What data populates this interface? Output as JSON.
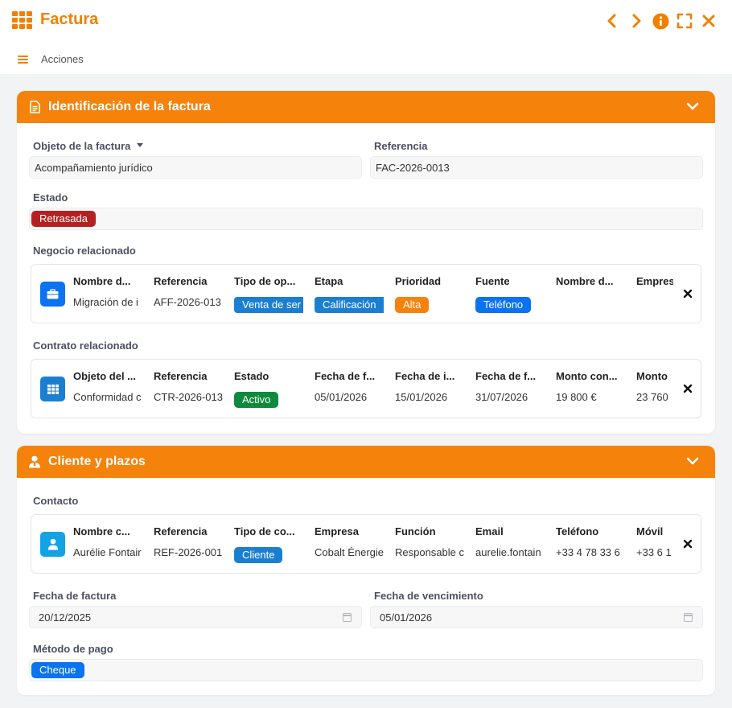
{
  "app": {
    "title": "Factura"
  },
  "toolbar": {
    "actions_label": "Acciones"
  },
  "colors": {
    "accent": "#f5820a",
    "delayed": "#b52121",
    "blue_badge": "#1b7fd1",
    "bright_blue": "#0a73ef",
    "green_badge": "#0f8a3c"
  },
  "section1": {
    "title": "Identificación de la factura",
    "invoice_object": {
      "label": "Objeto de la factura",
      "value": "Acompañamiento jurídico"
    },
    "reference": {
      "label": "Referencia",
      "value": "FAC-2026-0013"
    },
    "status": {
      "label": "Estado",
      "value": "Retrasada"
    },
    "related_deal": {
      "label": "Negocio relacionado",
      "icon": "briefcase-icon",
      "columns": [
        {
          "header": "Nombre d...",
          "value": "Migración de i"
        },
        {
          "header": "Referencia",
          "value": "AFF-2026-013"
        },
        {
          "header": "Tipo de op...",
          "value": "Venta de ser",
          "badge": "blue"
        },
        {
          "header": "Etapa",
          "value": "Calificación",
          "badge": "blue"
        },
        {
          "header": "Prioridad",
          "value": "Alta",
          "badge": "orange"
        },
        {
          "header": "Fuente",
          "value": "Teléfono",
          "badge": "bright"
        },
        {
          "header": "Nombre d...",
          "value": ""
        },
        {
          "header": "Empres",
          "value": ""
        }
      ]
    },
    "related_contract": {
      "label": "Contrato relacionado",
      "icon": "grid-icon",
      "columns": [
        {
          "header": "Objeto del ...",
          "value": "Conformidad c"
        },
        {
          "header": "Referencia",
          "value": "CTR-2026-013"
        },
        {
          "header": "Estado",
          "value": "Activo",
          "badge": "green"
        },
        {
          "header": "Fecha de f...",
          "value": "05/01/2026"
        },
        {
          "header": "Fecha de i...",
          "value": "15/01/2026"
        },
        {
          "header": "Fecha de f...",
          "value": "31/07/2026"
        },
        {
          "header": "Monto con...",
          "value": "19 800 €"
        },
        {
          "header": "Monto",
          "value": "23 760"
        }
      ]
    }
  },
  "section2": {
    "title": "Cliente y plazos",
    "contact": {
      "label": "Contacto",
      "icon": "person-icon",
      "columns": [
        {
          "header": "Nombre c...",
          "value": "Aurélie Fontair"
        },
        {
          "header": "Referencia",
          "value": "REF-2026-001"
        },
        {
          "header": "Tipo de co...",
          "value": "Cliente",
          "badge": "blue"
        },
        {
          "header": "Empresa",
          "value": "Cobalt Énergie"
        },
        {
          "header": "Función",
          "value": "Responsable c"
        },
        {
          "header": "Email",
          "value": "aurelie.fontain"
        },
        {
          "header": "Teléfono",
          "value": "+33 4 78 33 6"
        },
        {
          "header": "Móvil",
          "value": "+33 6 1"
        }
      ]
    },
    "invoice_date": {
      "label": "Fecha de factura",
      "value": "20/12/2025"
    },
    "due_date": {
      "label": "Fecha de vencimiento",
      "value": "05/01/2026"
    },
    "payment_method": {
      "label": "Método de pago",
      "value": "Cheque"
    }
  }
}
